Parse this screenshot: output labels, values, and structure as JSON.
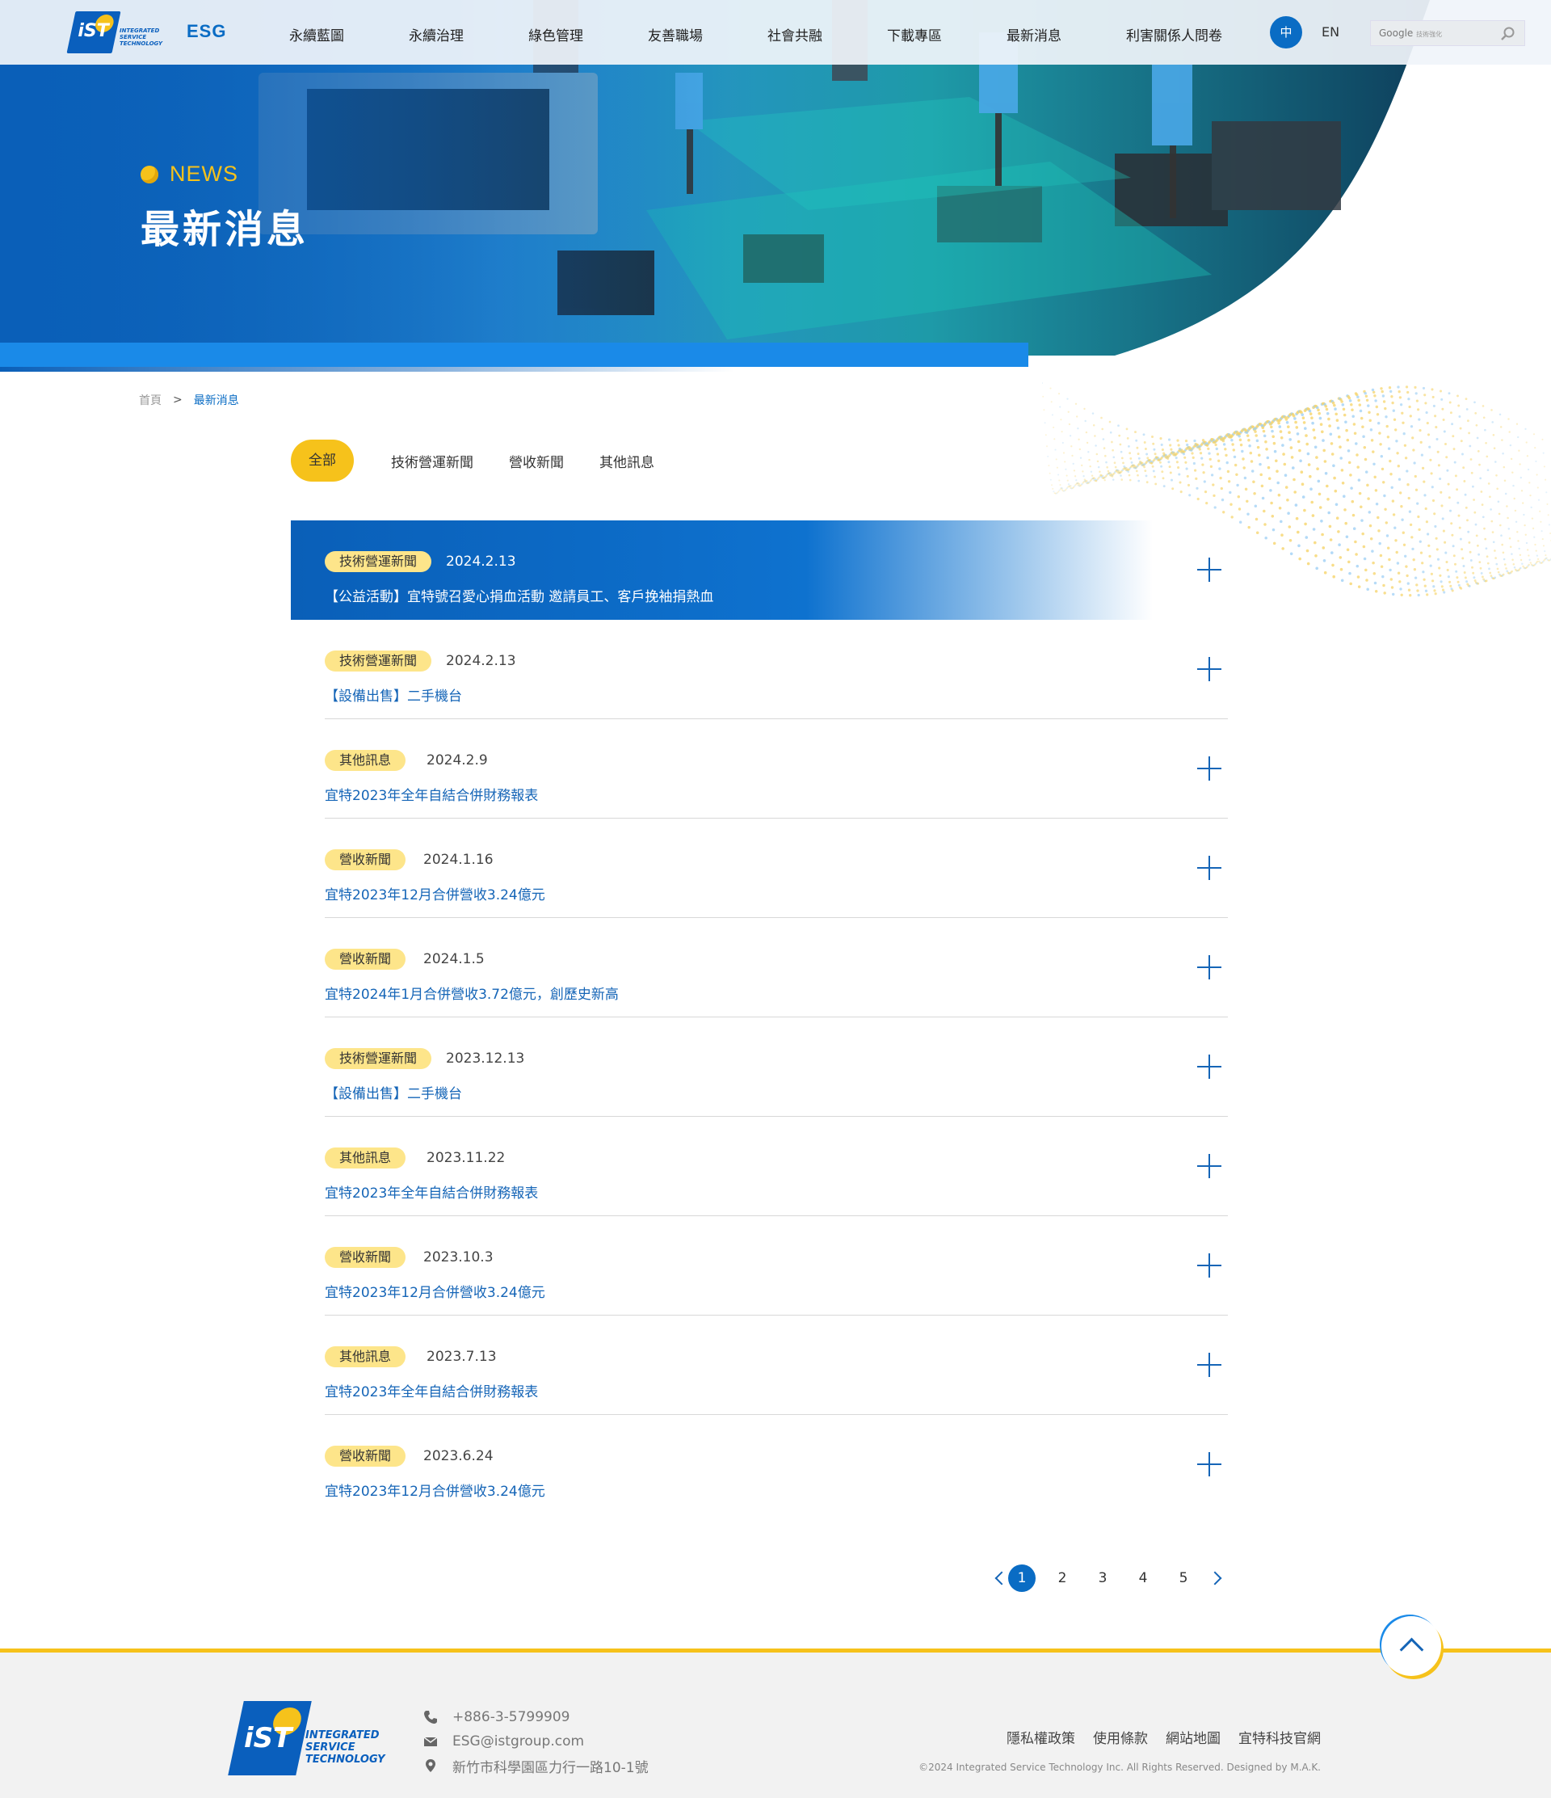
{
  "header": {
    "logo_text": "INTEGRATED SERVICE TECHNOLOGY",
    "logo_mark": "iST",
    "esg": "ESG",
    "nav": [
      "永續藍圖",
      "永續治理",
      "綠色管理",
      "友善職場",
      "社會共融",
      "下載專區",
      "最新消息",
      "利害關係人問卷"
    ],
    "lang_zh": "中",
    "lang_en": "EN",
    "search_brand": "Google",
    "search_hint": "技術強化"
  },
  "banner": {
    "eyebrow": "NEWS",
    "title": "最新消息"
  },
  "breadcrumb": {
    "home": "首頁",
    "current": "最新消息"
  },
  "filters": [
    "全部",
    "技術營運新聞",
    "營收新聞",
    "其他訊息"
  ],
  "news": [
    {
      "tag": "技術營運新聞",
      "date": "2024.2.13",
      "title": "【公益活動】宜特號召愛心捐血活動 邀請員工、客戶挽袖捐熱血"
    },
    {
      "tag": "技術營運新聞",
      "date": "2024.2.13",
      "title": "【設備出售】二手機台"
    },
    {
      "tag": "其他訊息",
      "date": "2024.2.9",
      "title": "宜特2023年全年自結合併財務報表"
    },
    {
      "tag": "營收新聞",
      "date": "2024.1.16",
      "title": "宜特2023年12月合併營收3.24億元"
    },
    {
      "tag": "營收新聞",
      "date": "2024.1.5",
      "title": "宜特2024年1月合併營收3.72億元，創歷史新高"
    },
    {
      "tag": "技術營運新聞",
      "date": "2023.12.13",
      "title": "【設備出售】二手機台"
    },
    {
      "tag": "其他訊息",
      "date": "2023.11.22",
      "title": "宜特2023年全年自結合併財務報表"
    },
    {
      "tag": "營收新聞",
      "date": "2023.10.3",
      "title": "宜特2023年12月合併營收3.24億元"
    },
    {
      "tag": "其他訊息",
      "date": "2023.7.13",
      "title": "宜特2023年全年自結合併財務報表"
    },
    {
      "tag": "營收新聞",
      "date": "2023.6.24",
      "title": "宜特2023年12月合併營收3.24億元"
    }
  ],
  "pagination": {
    "pages": [
      "1",
      "2",
      "3",
      "4",
      "5"
    ],
    "current": "1"
  },
  "footer": {
    "logo_text": "INTEGRATED SERVICE TECHNOLOGY",
    "logo_mark": "iST",
    "phone": "+886-3-5799909",
    "email": "ESG@istgroup.com",
    "address": "新竹市科學園區力行一路10-1號",
    "links": [
      "隱私權政策",
      "使用條款",
      "網站地圖",
      "宜特科技官網"
    ],
    "copyright": "©2024 Integrated Service Technology Inc. All Rights Reserved. Designed by M.A.K."
  },
  "colors": {
    "primary": "#0a6cc4",
    "accent": "#f6c21b",
    "tag_bg": "#fde58a"
  }
}
